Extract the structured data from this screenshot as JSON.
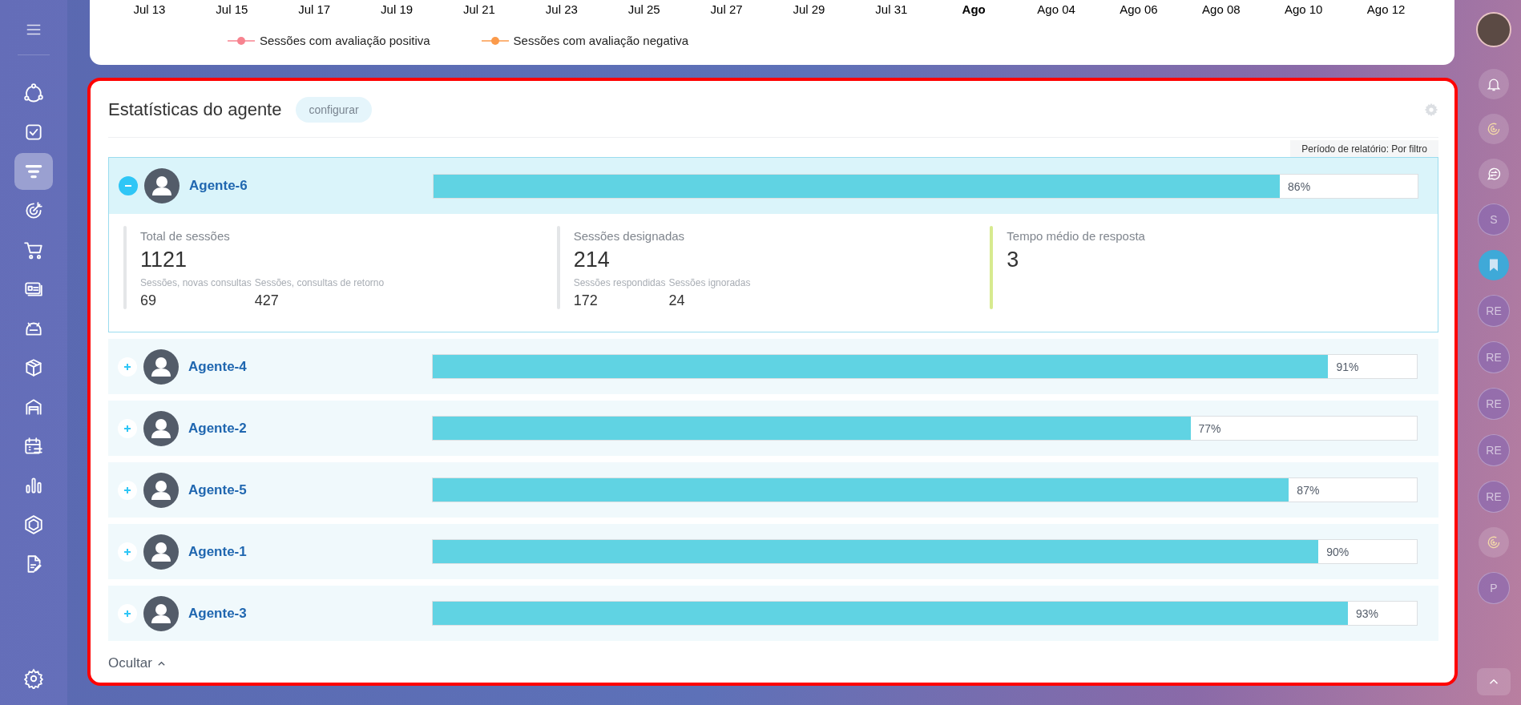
{
  "sidebar": {
    "items": [
      {
        "kind": "nodes",
        "selected": false
      },
      {
        "kind": "task",
        "selected": false
      },
      {
        "kind": "funnel",
        "selected": true
      },
      {
        "kind": "target",
        "selected": false
      },
      {
        "kind": "cart",
        "selected": false
      },
      {
        "kind": "card",
        "selected": false
      },
      {
        "kind": "robot",
        "selected": false
      },
      {
        "kind": "box",
        "selected": false
      },
      {
        "kind": "garage",
        "selected": false
      },
      {
        "kind": "calendar",
        "selected": false
      },
      {
        "kind": "chart",
        "selected": false
      },
      {
        "kind": "hexagon",
        "selected": false
      },
      {
        "kind": "document",
        "selected": false
      }
    ]
  },
  "chart": {
    "x_labels": [
      {
        "text": "Jul 13",
        "major": false
      },
      {
        "text": "Jul 15",
        "major": false
      },
      {
        "text": "Jul 17",
        "major": false
      },
      {
        "text": "Jul 19",
        "major": false
      },
      {
        "text": "Jul 21",
        "major": false
      },
      {
        "text": "Jul 23",
        "major": false
      },
      {
        "text": "Jul 25",
        "major": false
      },
      {
        "text": "Jul 27",
        "major": false
      },
      {
        "text": "Jul 29",
        "major": false
      },
      {
        "text": "Jul 31",
        "major": false
      },
      {
        "text": "Ago",
        "major": true
      },
      {
        "text": "Ago 04",
        "major": false
      },
      {
        "text": "Ago 06",
        "major": false
      },
      {
        "text": "Ago 08",
        "major": false
      },
      {
        "text": "Ago 10",
        "major": false
      },
      {
        "text": "Ago 12",
        "major": false
      }
    ],
    "legend": [
      {
        "label": "Sessões com avaliação positiva",
        "color": "#f7838f"
      },
      {
        "label": "Sessões com avaliação negativa",
        "color": "#fb9a4b"
      }
    ]
  },
  "agent_stats": {
    "title": "Estatísticas do agente",
    "configure_button": "configurar",
    "period": "Período de relatório: Por filtro",
    "agents": [
      {
        "name": "Agente-6",
        "level": 0.86,
        "percent": "86%",
        "expanded": true,
        "stats": [
          {
            "label": "Total de sessões",
            "value": "1121",
            "color": "#e4e6e8",
            "sub": [
              {
                "label": "Sessões, novas consultas",
                "value": "69"
              },
              {
                "label": "Sessões, consultas de retorno",
                "value": "427"
              }
            ]
          },
          {
            "label": "Sessões designadas",
            "value": "214",
            "color": "#e4e6e8",
            "sub": [
              {
                "label": "Sessões respondidas",
                "value": "172"
              },
              {
                "label": "Sessões ignoradas",
                "value": "24"
              }
            ]
          },
          {
            "label": "Tempo médio de resposta",
            "value": "3",
            "color": "#d7ea8f"
          }
        ]
      },
      {
        "name": "Agente-4",
        "level": 0.91,
        "percent": "91%",
        "expanded": false
      },
      {
        "name": "Agente-2",
        "level": 0.77,
        "percent": "77%",
        "expanded": false
      },
      {
        "name": "Agente-5",
        "level": 0.87,
        "percent": "87%",
        "expanded": false
      },
      {
        "name": "Agente-1",
        "level": 0.9,
        "percent": "90%",
        "expanded": false
      },
      {
        "name": "Agente-3",
        "level": 0.93,
        "percent": "93%",
        "expanded": false
      }
    ],
    "hide_link": "Ocultar"
  },
  "right_bar": {
    "items": [
      {
        "kind": "bell"
      },
      {
        "kind": "swirl"
      },
      {
        "kind": "chat"
      },
      {
        "kind": "letter",
        "label": "S"
      },
      {
        "kind": "bookmark"
      },
      {
        "kind": "letter",
        "label": "RE"
      },
      {
        "kind": "letter",
        "label": "RE"
      },
      {
        "kind": "letter",
        "label": "RE"
      },
      {
        "kind": "letter",
        "label": "RE"
      },
      {
        "kind": "letter",
        "label": "RE"
      },
      {
        "kind": "swirl"
      },
      {
        "kind": "letter",
        "label": "P"
      }
    ]
  }
}
